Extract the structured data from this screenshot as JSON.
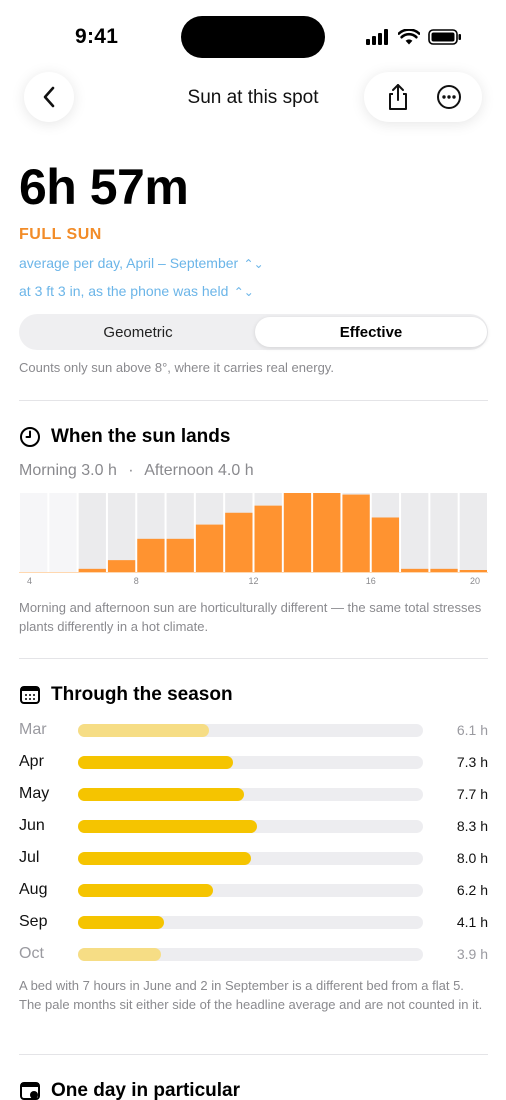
{
  "status_bar": {
    "time": "9:41"
  },
  "nav": {
    "title": "Sun at this spot"
  },
  "summary": {
    "duration": "6h 57m",
    "category": "FULL SUN",
    "period_link": "average per day, April – September",
    "height_link": "at 3 ft 3 in, as the phone was held"
  },
  "mode": {
    "options": [
      "Geometric",
      "Effective"
    ],
    "selected": "Effective"
  },
  "mode_note": "Counts only sun above 8°, where it carries real energy.",
  "when_section": {
    "title": "When the sun lands",
    "morning": "Morning 3.0 h",
    "separator": "·",
    "afternoon": "Afternoon 4.0 h",
    "note": "Morning and afternoon sun are horticulturally different — the same total stresses plants differently in a hot climate."
  },
  "chart_data": {
    "type": "bar",
    "x": [
      4,
      5,
      6,
      7,
      8,
      9,
      10,
      11,
      12,
      13,
      14,
      15,
      16,
      17,
      18,
      19,
      20
    ],
    "values": [
      0,
      0,
      0.04,
      0.15,
      0.42,
      0.42,
      0.6,
      0.75,
      0.84,
      1.0,
      1.0,
      0.98,
      0.69,
      0.04,
      0.04,
      0.01
    ],
    "daylight_hours": [
      6,
      7,
      8,
      9,
      10,
      11,
      12,
      13,
      14,
      15,
      16,
      17,
      18,
      19
    ],
    "tick_labels": [
      "4",
      "8",
      "12",
      "16",
      "20"
    ],
    "xlabel": "",
    "ylabel": "",
    "ylim": [
      0,
      1
    ],
    "colors": {
      "bar": "#FF9330",
      "daylight": "#EBEBED",
      "night": "#F6F6F8"
    }
  },
  "season_section": {
    "title": "Through the season",
    "months": [
      {
        "month": "Mar",
        "hours": 6.1,
        "label": "6.1 h",
        "counted": false
      },
      {
        "month": "Apr",
        "hours": 7.3,
        "label": "7.3 h",
        "counted": true
      },
      {
        "month": "May",
        "hours": 7.7,
        "label": "7.7 h",
        "counted": true
      },
      {
        "month": "Jun",
        "hours": 8.3,
        "label": "8.3 h",
        "counted": true
      },
      {
        "month": "Jul",
        "hours": 8.0,
        "label": "8.0 h",
        "counted": true
      },
      {
        "month": "Aug",
        "hours": 6.2,
        "label": "6.2 h",
        "counted": true
      },
      {
        "month": "Sep",
        "hours": 4.1,
        "label": "4.1 h",
        "counted": true
      },
      {
        "month": "Oct",
        "hours": 3.9,
        "label": "3.9 h",
        "counted": false
      }
    ],
    "bar_fill_fraction": [
      0.38,
      0.45,
      0.48,
      0.52,
      0.5,
      0.39,
      0.25,
      0.24
    ],
    "note": "A bed with 7 hours in June and 2 in September is a different bed from a flat 5. The pale months sit either side of the headline average and are not counted in it."
  },
  "day_section": {
    "title": "One day in particular"
  },
  "colors": {
    "accent_orange": "#F28C28",
    "link_blue": "#6BB5E8",
    "season_fill": "#F5C400",
    "season_fill_pale": "#F6DD85"
  }
}
